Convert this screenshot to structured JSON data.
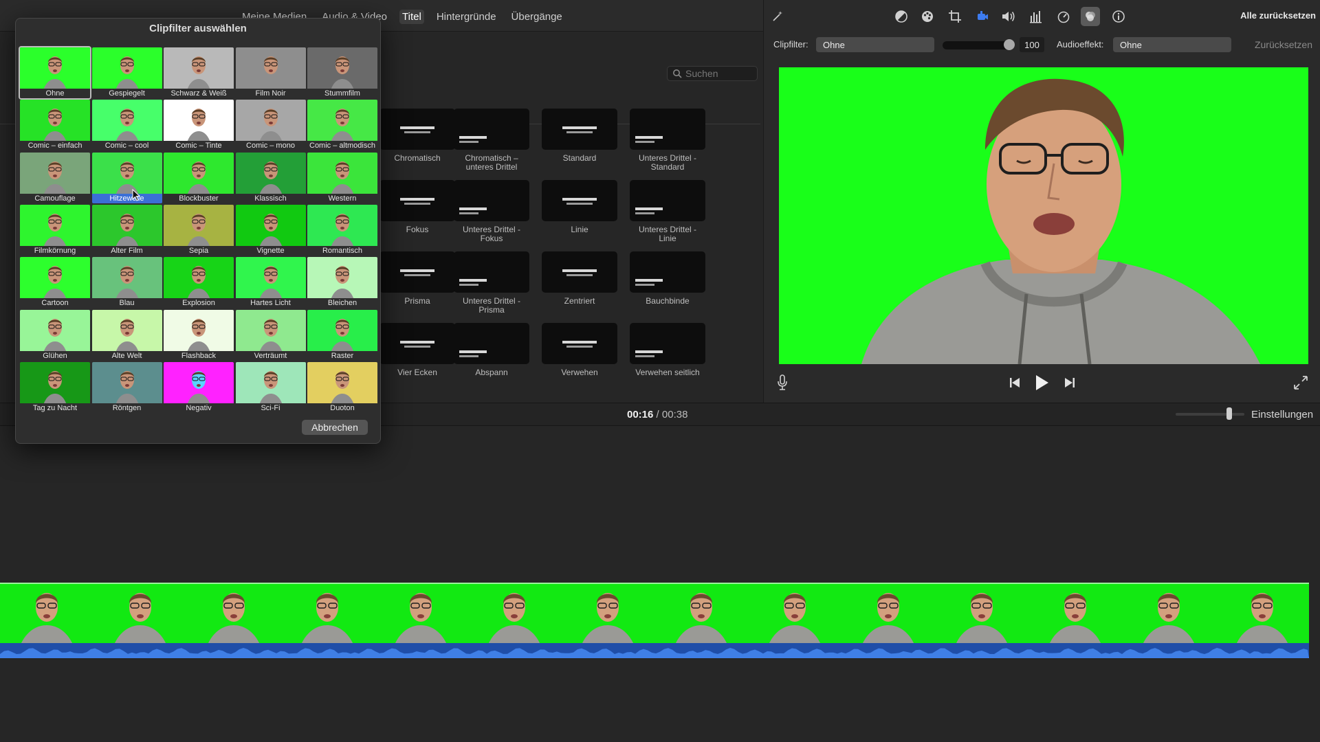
{
  "nav": {
    "tabs": [
      "Meine Medien",
      "Audio & Video",
      "Titel",
      "Hintergründe",
      "Übergänge"
    ],
    "active_tab": "Titel"
  },
  "browser": {
    "search_placeholder": "Suchen",
    "templates": [
      [
        "Chromatisch",
        "Chromatisch – unteres Drittel",
        "Standard",
        "Unteres Drittel - Standard"
      ],
      [
        "Fokus",
        "Unteres Drittel - Fokus",
        "Linie",
        "Unteres Drittel - Linie"
      ],
      [
        "Prisma",
        "Unteres Drittel - Prisma",
        "Zentriert",
        "Bauchbinde"
      ],
      [
        "Vier Ecken",
        "Abspann",
        "Verwehen",
        "Verwehen seitlich"
      ]
    ]
  },
  "popup": {
    "title": "Clipfilter auswählen",
    "cancel_label": "Abbrechen",
    "selected": "Ohne",
    "hovered": "Hitzewelle",
    "filters": [
      [
        "Ohne",
        "Gespiegelt",
        "Schwarz & Weiß",
        "Film Noir",
        "Stummfilm"
      ],
      [
        "Comic – einfach",
        "Comic – cool",
        "Comic – Tinte",
        "Comic – mono",
        "Comic – altmodisch"
      ],
      [
        "Camouflage",
        "Hitzewelle",
        "Blockbuster",
        "Klassisch",
        "Western"
      ],
      [
        "Filmkörnung",
        "Alter Film",
        "Sepia",
        "Vignette",
        "Romantisch"
      ],
      [
        "Cartoon",
        "Blau",
        "Explosion",
        "Hartes Licht",
        "Bleichen"
      ],
      [
        "Glühen",
        "Alte Welt",
        "Flashback",
        "Verträumt",
        "Raster"
      ],
      [
        "Tag zu Nacht",
        "Röntgen",
        "Negativ",
        "Sci-Fi",
        "Duoton"
      ]
    ]
  },
  "inspector": {
    "reset_all_label": "Alle zurücksetzen",
    "clip_filter_label": "Clipfilter:",
    "clip_filter_value": "Ohne",
    "strength_value": "100",
    "audio_effect_label": "Audioeffekt:",
    "audio_effect_value": "Ohne",
    "reset_label": "Zurücksetzen"
  },
  "timeline": {
    "current_time": "00:16",
    "separator": "/",
    "total_time": "00:38",
    "settings_label": "Einstellungen"
  },
  "colors": {
    "greenscreen": "#19ff19",
    "highlight": "#3b6fd6"
  }
}
